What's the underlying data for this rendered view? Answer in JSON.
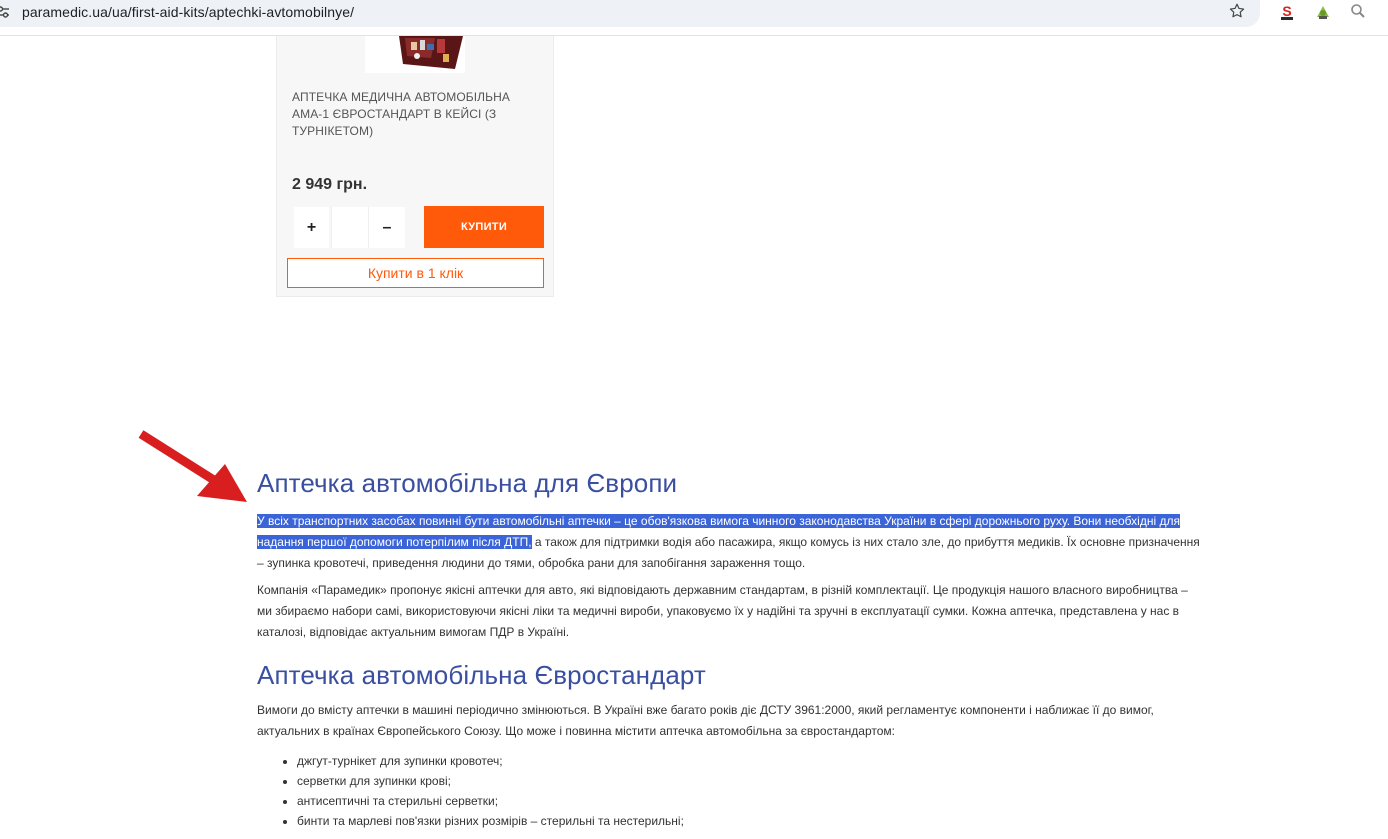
{
  "browser": {
    "url": "paramedic.ua/ua/first-aid-kits/aptechki-avtomobilnye/"
  },
  "product": {
    "title": "АПТЕЧКА МЕДИЧНА АВТОМОБІЛЬНА АМА-1 ЄВРОСТАНДАРТ В КЕЙСІ (З ТУРНІКЕТОМ)",
    "price": "2 949 грн.",
    "qty_plus": "+",
    "qty_minus": "–",
    "qty_value": "",
    "buy_label": "КУПИТИ",
    "buy_one_click_label": "Купити в 1 клік"
  },
  "article": {
    "heading1": "Аптечка автомобільна для Європи",
    "para1_highlighted": "У всіх транспортних засобах повинні бути автомобільні аптечки – це обов'язкова вимога чинного законодавства України в сфері дорожнього руху. Вони необхідні для надання першої допомоги потерпілим після ДТП,",
    "para1_rest": " а також для підтримки водія або пасажира, якщо комусь із них стало зле, до прибуття медиків. Їх основне призначення – зупинка кровотечі, приведення людини до тями, обробка рани для запобігання зараження тощо.",
    "para2": "Компанія «Парамедик» пропонує якісні аптечки для авто, які відповідають державним стандартам, в різній комплектації. Це продукція нашого власного виробництва – ми збираємо набори самі, використовуючи якісні ліки та медичні вироби, упаковуємо їх у надійні та зручні в експлуатації сумки. Кожна аптечка, представлена у нас в каталозі, відповідає актуальним вимогам ПДР в Україні.",
    "heading2": "Аптечка автомобільна Євростандарт",
    "para3": "Вимоги до вмісту аптечки в машині періодично змінюються. В Україні вже багато років діє ДСТУ 3961:2000, який регламентує компоненти і наближає її до вимог, актуальних в країнах Європейського Союзу. Що може і повинна містити аптечка автомобільна за євростандартом:",
    "bullets": [
      "джгут-турнікет для зупинки кровотеч;",
      "серветки для зупинки крові;",
      "антисептичні та стерильні серветки;",
      "бинти та марлеві пов'язки різних розмірів – стерильні та нестерильні;"
    ]
  },
  "colors": {
    "accent": "#ff5a0a",
    "heading": "#3a4fa0",
    "highlight": "#3a64d8",
    "arrow": "#d81e1e"
  },
  "icons": [
    "tune-icon",
    "star-icon",
    "extension-icon",
    "extension-icon",
    "search-icon",
    "arrow-icon"
  ]
}
